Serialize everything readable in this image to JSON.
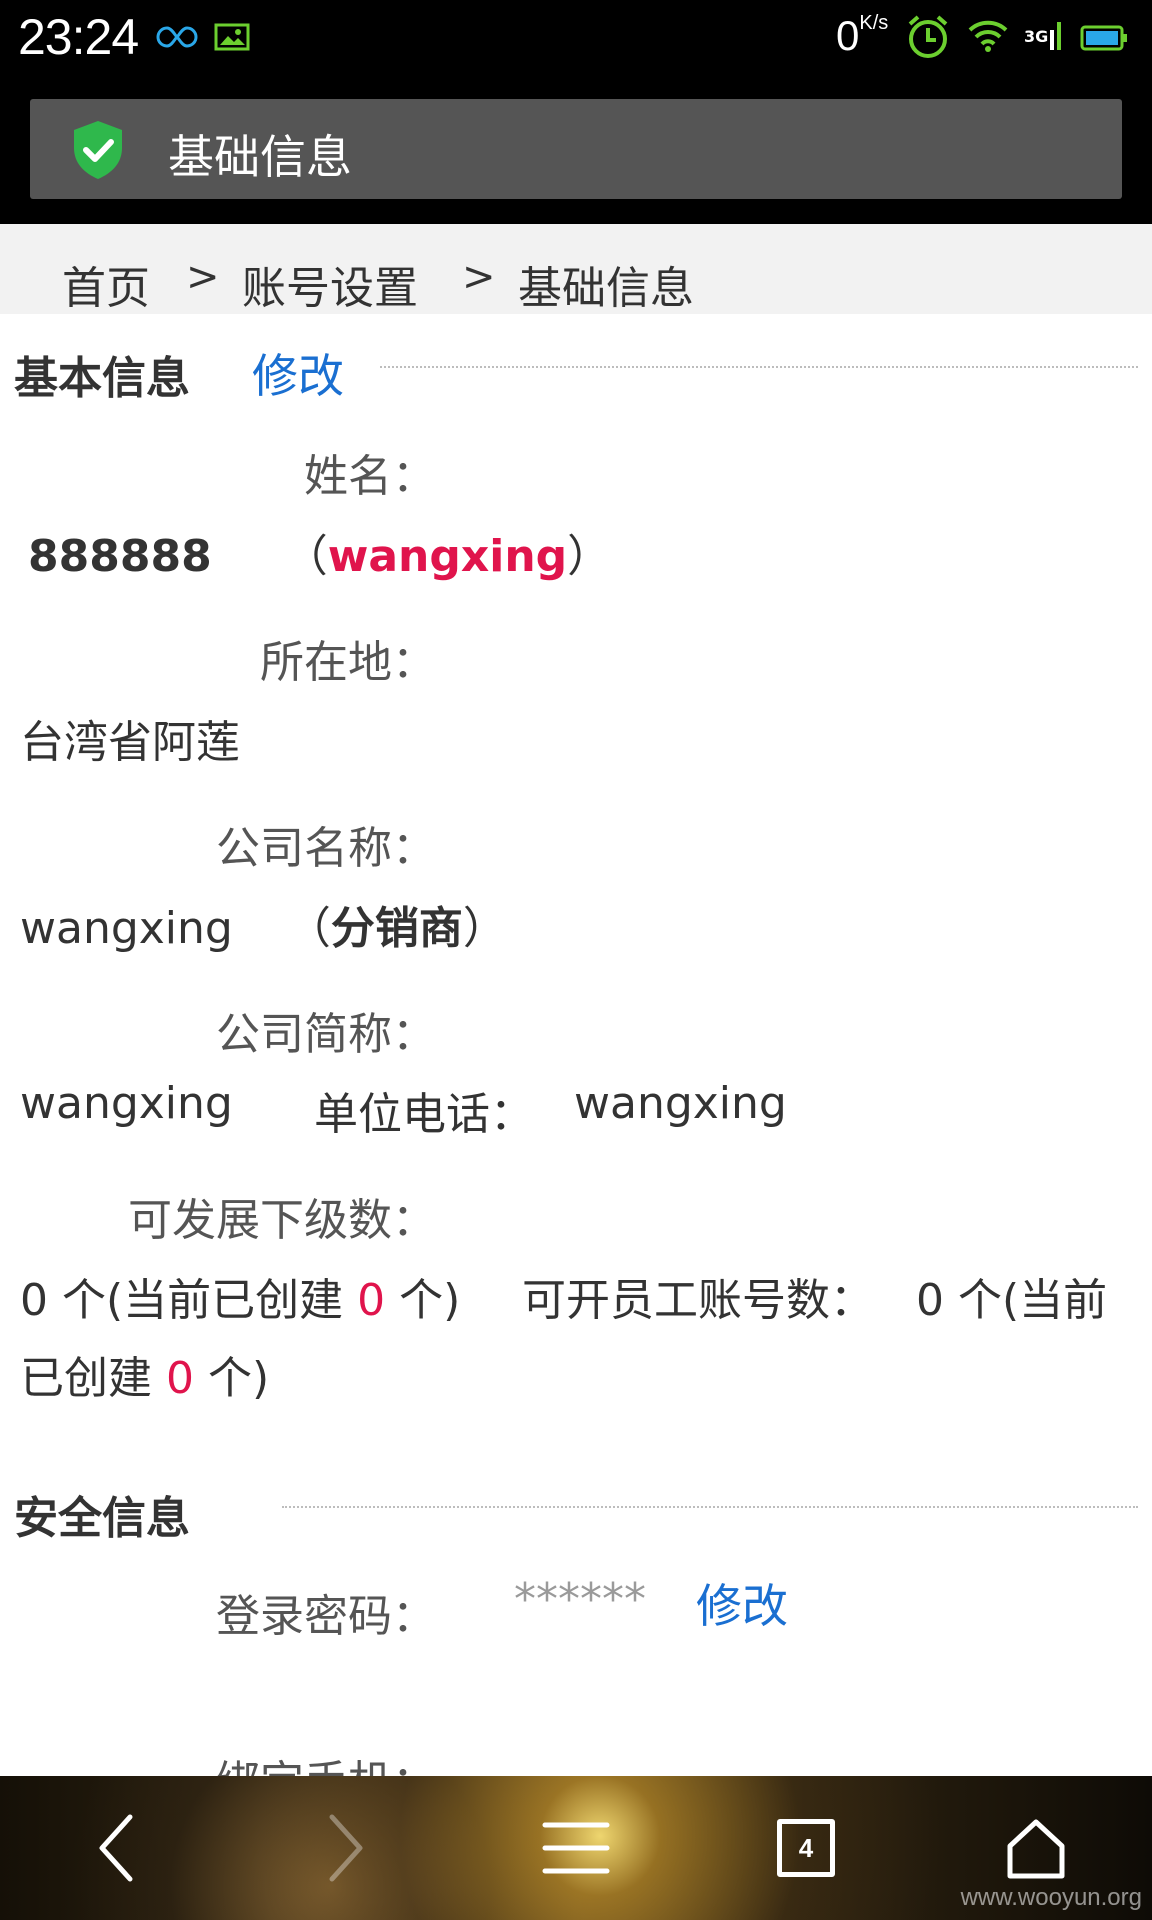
{
  "status_bar": {
    "time": "23:24",
    "net_speed_value": "0",
    "net_speed_unit": "K/s",
    "icons": [
      "infinity-icon",
      "image-icon",
      "alarm-icon",
      "wifi-icon",
      "signal-3g-icon",
      "battery-icon"
    ]
  },
  "title_bar": {
    "title": "基础信息",
    "icon": "shield-check-icon"
  },
  "breadcrumb": {
    "items": [
      "首页",
      "账号设置",
      "基础信息"
    ],
    "separator": ">"
  },
  "basic_info": {
    "section_title": "基本信息",
    "edit_label": "修改",
    "name_label": "姓名：",
    "name_value": "888888",
    "name_paren_open": "（",
    "username": "wangxing",
    "name_paren_close": "）",
    "location_label": "所在地：",
    "location_value": "台湾省阿莲",
    "company_name_label": "公司名称：",
    "company_name_value": "wangxing",
    "company_type_open": "（",
    "company_type": "分销商",
    "company_type_close": "）",
    "company_short_label": "公司简称：",
    "company_short_value": "wangxing",
    "phone_label": "单位电话：",
    "phone_value": "wangxing",
    "sub_level_label": "可发展下级数：",
    "sub_level_count": "0 个(当前已创建 ",
    "sub_level_created": "0",
    "sub_level_suffix": " 个)",
    "staff_label": "可开员工账号数：",
    "staff_count": "0 个(当前",
    "staff_count_line2": "已创建 ",
    "staff_created": "0",
    "staff_suffix": " 个)"
  },
  "security_info": {
    "section_title": "安全信息",
    "password_label": "登录密码：",
    "password_value": "******",
    "password_edit_label": "修改",
    "phone_bind_label": "绑定手机："
  },
  "bottom_nav": {
    "tab_count": "4",
    "watermark": "www.wooyun.org"
  },
  "colors": {
    "accent_blue": "#1a6fd1",
    "highlight_red": "#e0144c",
    "status_green": "#6ccf2f"
  }
}
